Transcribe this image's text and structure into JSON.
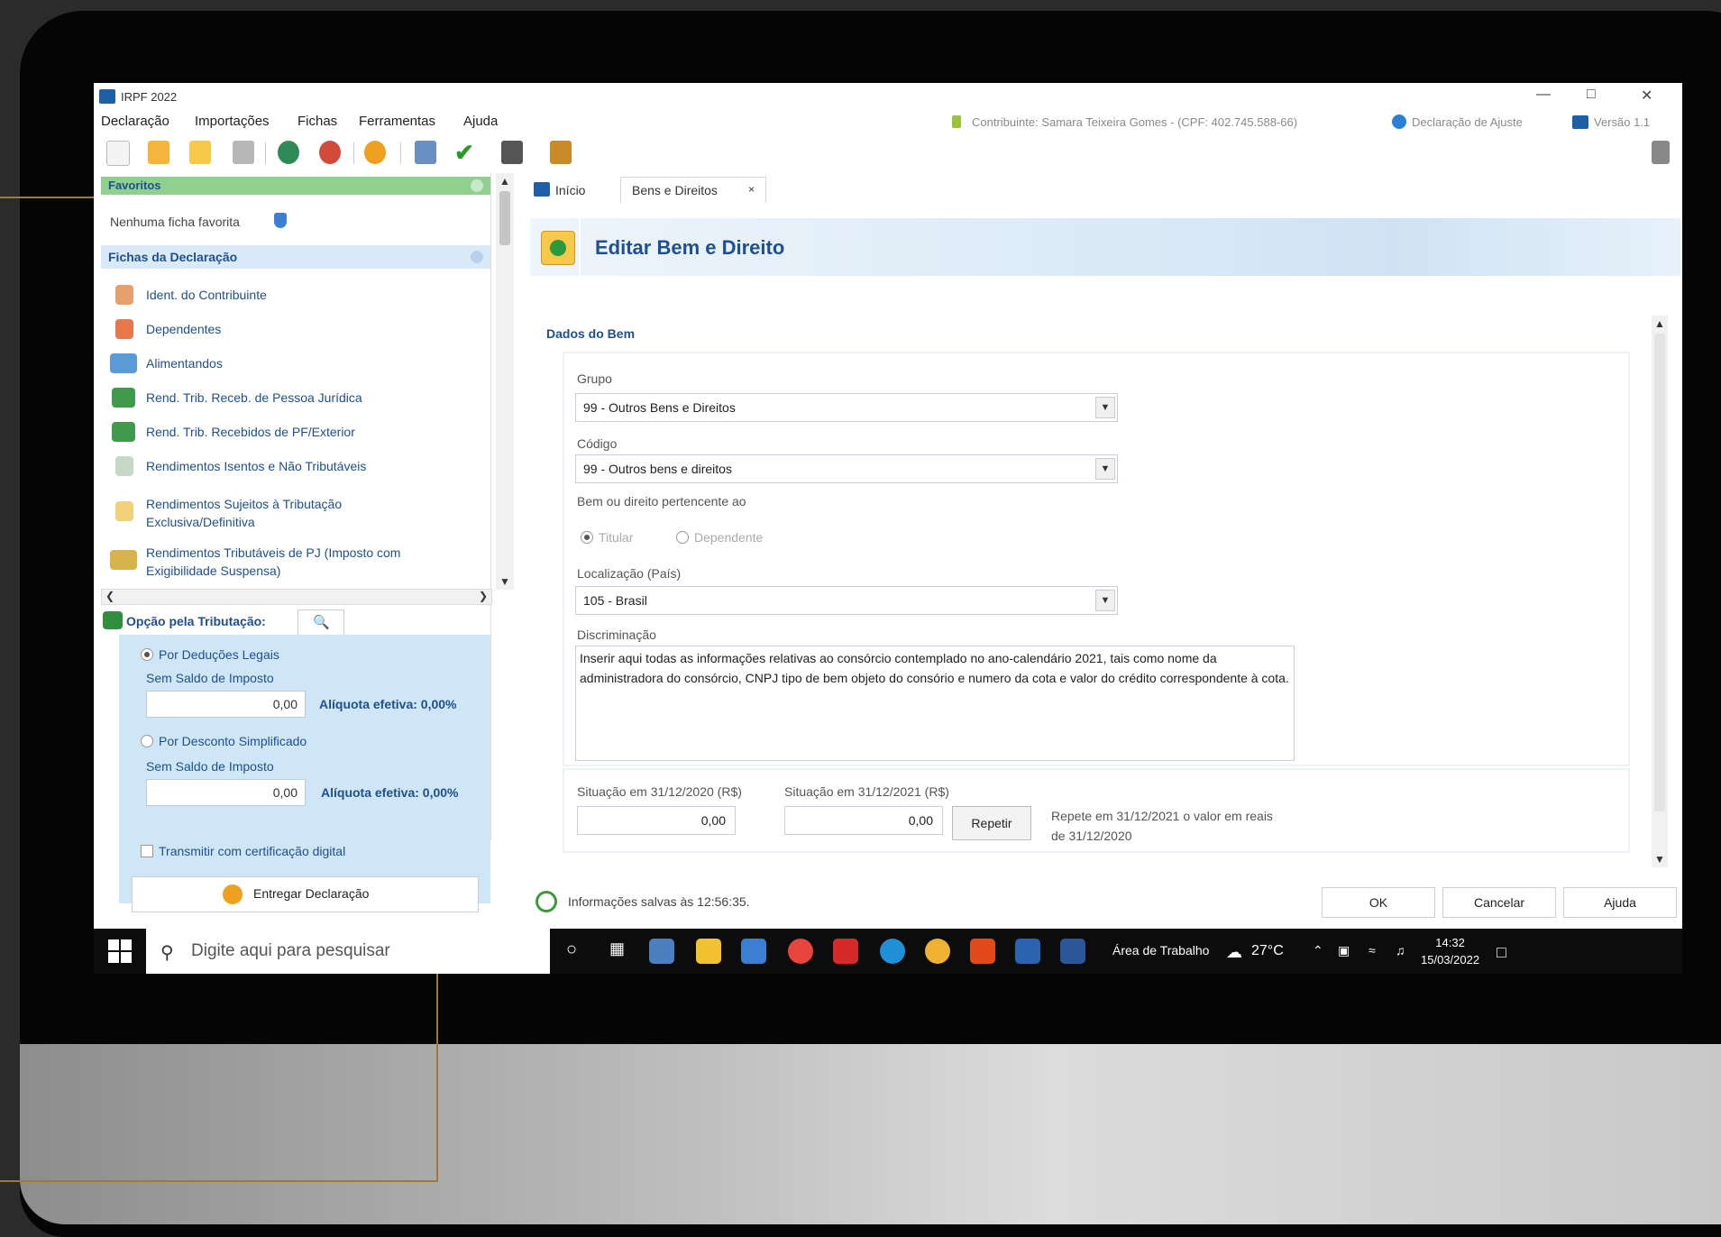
{
  "window": {
    "title": "IRPF 2022"
  },
  "menu": [
    "Declaração",
    "Importações",
    "Fichas",
    "Ferramentas",
    "Ajuda"
  ],
  "header_info": {
    "contribuinte": "Contribuinte: Samara Teixeira Gomes - (CPF: 402.745.588-66)",
    "tipo": "Declaração de Ajuste",
    "versao": "Versão 1.1"
  },
  "sidebar": {
    "favoritos_title": "Favoritos",
    "favoritos_empty": "Nenhuma ficha favorita",
    "fichas_title": "Fichas da Declaração",
    "fichas": [
      "Ident. do Contribuinte",
      "Dependentes",
      "Alimentandos",
      "Rend. Trib. Receb. de Pessoa Jurídica",
      "Rend. Trib. Recebidos de PF/Exterior",
      "Rendimentos Isentos e Não Tributáveis",
      "Rendimentos Sujeitos à Tributação",
      "Exclusiva/Definitiva",
      "Rendimentos Tributáveis de PJ (Imposto com",
      "Exigibilidade Suspensa)"
    ],
    "opcao_title": "Opção pela Tributação:",
    "opcoes": [
      {
        "label": "Por Deduções Legais",
        "sub": "Sem Saldo de Imposto",
        "value": "0,00",
        "aliquota": "Alíquota efetiva: 0,00%"
      },
      {
        "label": "Por Desconto Simplificado",
        "sub": "Sem Saldo de Imposto",
        "value": "0,00",
        "aliquota": "Alíquota efetiva: 0,00%"
      }
    ],
    "transmitir": "Transmitir com certificação digital",
    "entregar": "Entregar Declaração"
  },
  "tabs": {
    "inicio": "Início",
    "bens": "Bens e Direitos",
    "close": "×"
  },
  "form": {
    "banner_title": "Editar Bem e Direito",
    "section": "Dados do Bem",
    "grupo_label": "Grupo",
    "grupo_value": "99 - Outros Bens e Direitos",
    "codigo_label": "Código",
    "codigo_value": "99 - Outros bens e direitos",
    "pertencente_label": "Bem ou direito pertencente ao",
    "titular": "Titular",
    "dependente": "Dependente",
    "localizacao_label": "Localização (País)",
    "localizacao_value": "105 - Brasil",
    "discriminacao_label": "Discriminação",
    "discriminacao_value": "Inserir aqui todas as informações relativas ao consórcio contemplado no ano-calendário 2021, tais como nome da administradora do consórcio, CNPJ tipo de bem objeto do consório e numero da cota e valor do crédito correspondente à cota.",
    "sit2020_label": "Situação em 31/12/2020 (R$)",
    "sit2020_value": "0,00",
    "sit2021_label": "Situação em 31/12/2021 (R$)",
    "sit2021_value": "0,00",
    "repetir": "Repetir",
    "repete_text": "Repete em 31/12/2021 o valor em reais de 31/12/2020"
  },
  "status": {
    "saved": "Informações salvas às 12:56:35.",
    "ok": "OK",
    "cancelar": "Cancelar",
    "ajuda": "Ajuda"
  },
  "taskbar": {
    "search_placeholder": "Digite aqui para pesquisar",
    "area": "Área de Trabalho",
    "temp": "27°C",
    "time": "14:32",
    "date": "15/03/2022"
  }
}
